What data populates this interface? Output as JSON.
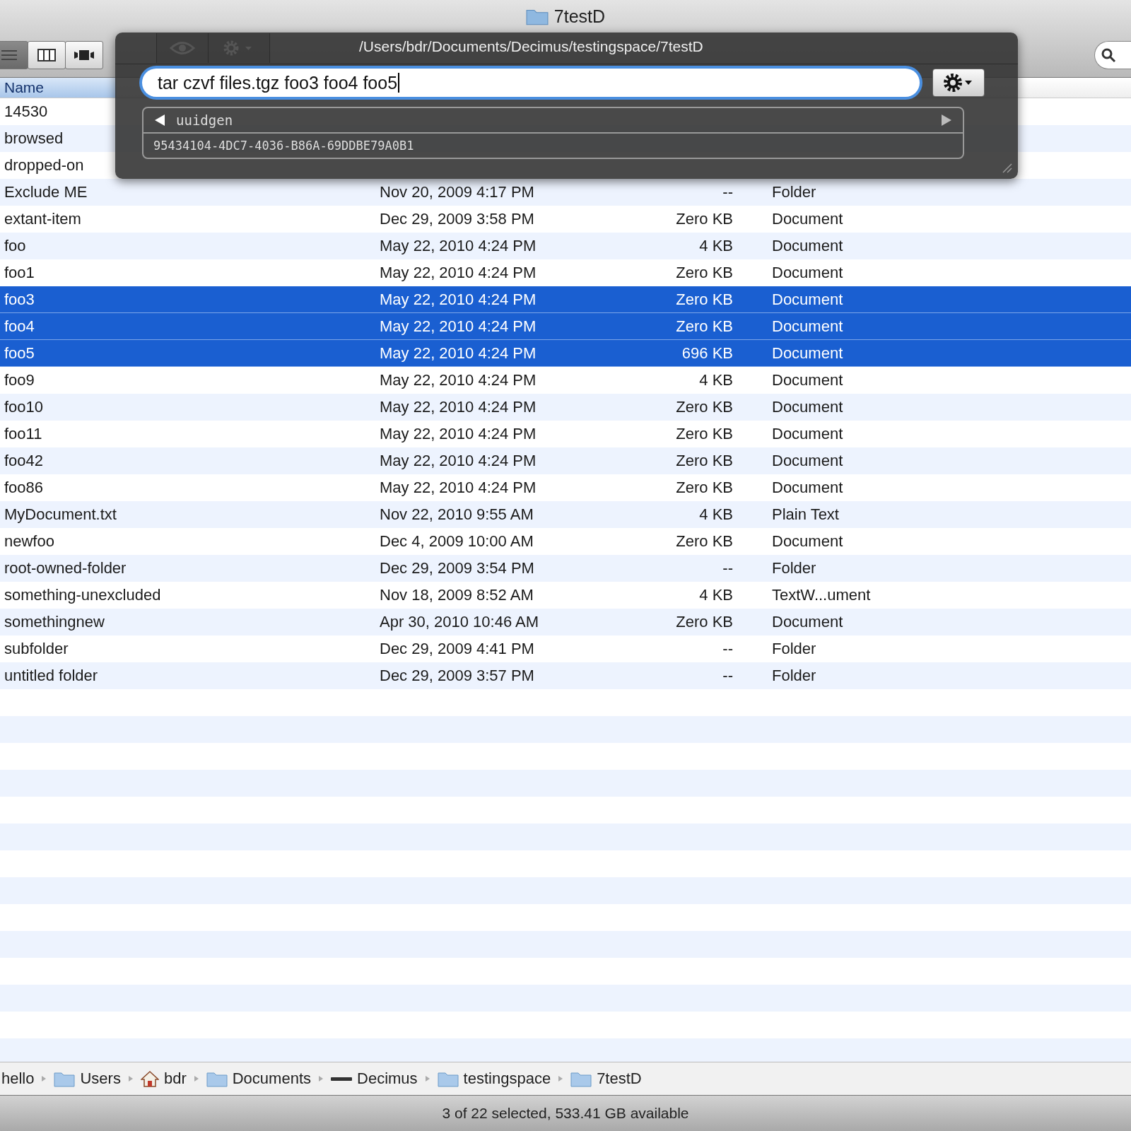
{
  "window": {
    "title": "7testD"
  },
  "view_buttons": [
    {
      "kind": "list",
      "selected": true
    },
    {
      "kind": "columns",
      "selected": false
    },
    {
      "kind": "coverflow",
      "selected": false
    }
  ],
  "command_panel": {
    "path": "/Users/bdr/Documents/Decimus/testingspace/7testD",
    "command": "tar czvf files.tgz foo3 foo4 foo5",
    "history_command": "uuidgen",
    "history_output": "95434104-4DC7-4036-B86A-69DDBE79A0B1"
  },
  "table": {
    "columns": [
      {
        "label": "Name",
        "selected": true
      }
    ],
    "rows": [
      {
        "name": "14530",
        "selected": false
      },
      {
        "name": "browsed",
        "selected": false
      },
      {
        "name": "dropped-on",
        "selected": false
      },
      {
        "name": "Exclude ME",
        "date": "Nov 20, 2009 4:17 PM",
        "size": "--",
        "kind": "Folder",
        "selected": false
      },
      {
        "name": "extant-item",
        "date": "Dec 29, 2009 3:58 PM",
        "size": "Zero KB",
        "kind": "Document",
        "selected": false
      },
      {
        "name": "foo",
        "date": "May 22, 2010 4:24 PM",
        "size": "4 KB",
        "kind": "Document",
        "selected": false
      },
      {
        "name": "foo1",
        "date": "May 22, 2010 4:24 PM",
        "size": "Zero KB",
        "kind": "Document",
        "selected": false
      },
      {
        "name": "foo3",
        "date": "May 22, 2010 4:24 PM",
        "size": "Zero KB",
        "kind": "Document",
        "selected": true
      },
      {
        "name": "foo4",
        "date": "May 22, 2010 4:24 PM",
        "size": "Zero KB",
        "kind": "Document",
        "selected": true
      },
      {
        "name": "foo5",
        "date": "May 22, 2010 4:24 PM",
        "size": "696 KB",
        "kind": "Document",
        "selected": true
      },
      {
        "name": "foo9",
        "date": "May 22, 2010 4:24 PM",
        "size": "4 KB",
        "kind": "Document",
        "selected": false
      },
      {
        "name": "foo10",
        "date": "May 22, 2010 4:24 PM",
        "size": "Zero KB",
        "kind": "Document",
        "selected": false
      },
      {
        "name": "foo11",
        "date": "May 22, 2010 4:24 PM",
        "size": "Zero KB",
        "kind": "Document",
        "selected": false
      },
      {
        "name": "foo42",
        "date": "May 22, 2010 4:24 PM",
        "size": "Zero KB",
        "kind": "Document",
        "selected": false
      },
      {
        "name": "foo86",
        "date": "May 22, 2010 4:24 PM",
        "size": "Zero KB",
        "kind": "Document",
        "selected": false
      },
      {
        "name": "MyDocument.txt",
        "date": "Nov 22, 2010 9:55 AM",
        "size": "4 KB",
        "kind": "Plain Text",
        "selected": false
      },
      {
        "name": "newfoo",
        "date": "Dec 4, 2009 10:00 AM",
        "size": "Zero KB",
        "kind": "Document",
        "selected": false
      },
      {
        "name": "root-owned-folder",
        "date": "Dec 29, 2009 3:54 PM",
        "size": "--",
        "kind": "Folder",
        "selected": false
      },
      {
        "name": "something-unexcluded",
        "date": "Nov 18, 2009 8:52 AM",
        "size": "4 KB",
        "kind": "TextW...ument",
        "selected": false
      },
      {
        "name": "somethingnew",
        "date": "Apr 30, 2010 10:46 AM",
        "size": "Zero KB",
        "kind": "Document",
        "selected": false
      },
      {
        "name": "subfolder",
        "date": "Dec 29, 2009 4:41 PM",
        "size": "--",
        "kind": "Folder",
        "selected": false
      },
      {
        "name": "untitled folder",
        "date": "Dec 29, 2009 3:57 PM",
        "size": "--",
        "kind": "Folder",
        "selected": false
      }
    ]
  },
  "path_bar": [
    {
      "label": "hello",
      "kind": "plain"
    },
    {
      "label": "Users",
      "kind": "folder"
    },
    {
      "label": "bdr",
      "kind": "home"
    },
    {
      "label": "Documents",
      "kind": "folder"
    },
    {
      "label": "Decimus",
      "kind": "disk"
    },
    {
      "label": "testingspace",
      "kind": "folder"
    },
    {
      "label": "7testD",
      "kind": "folder"
    }
  ],
  "status_bar": "3 of 22 selected, 533.41 GB available"
}
